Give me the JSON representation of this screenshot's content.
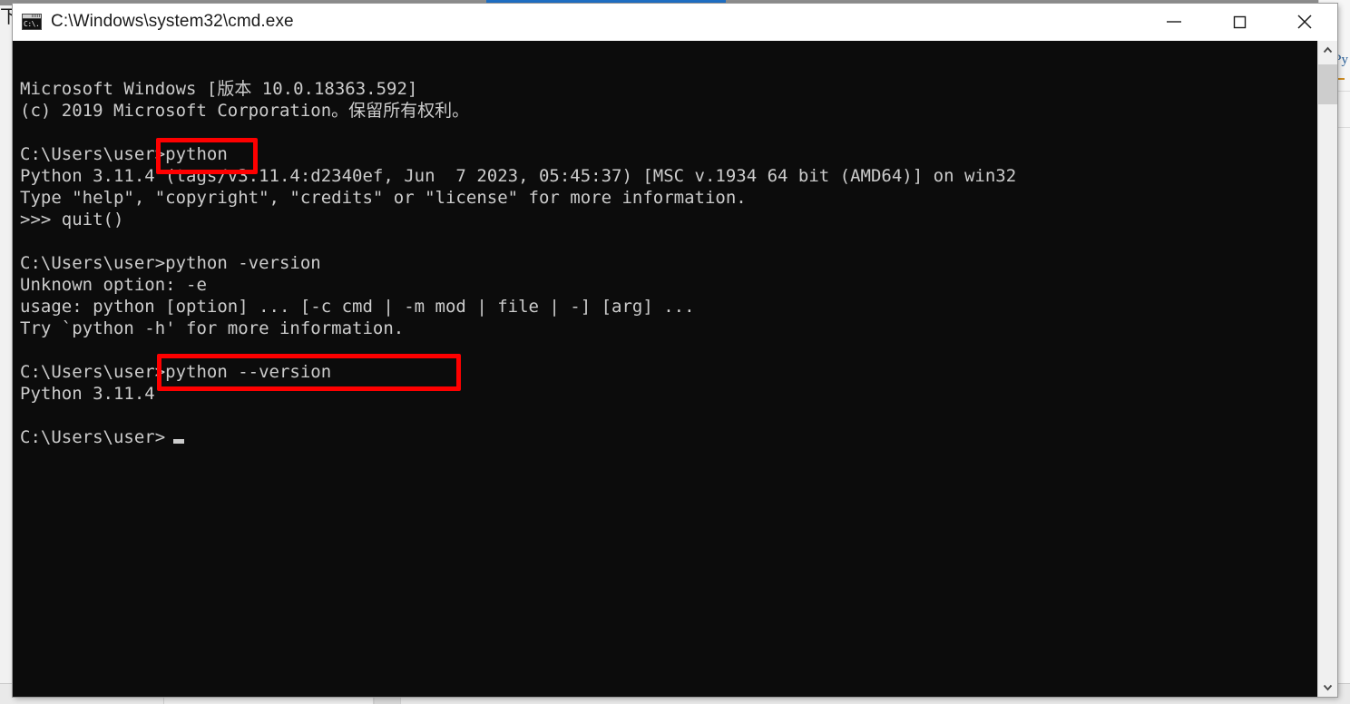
{
  "window": {
    "title": "C:\\Windows\\system32\\cmd.exe",
    "icon": "cmd-icon",
    "icon_glyph": "C:\\.",
    "controls": {
      "minimize_label": "Minimize",
      "maximize_label": "Maximize",
      "close_label": "Close"
    },
    "colors": {
      "titlebar_bg": "#ffffff",
      "titlebar_fg": "#1b1b1b",
      "console_bg": "#0c0c0c",
      "console_fg": "#cccccc",
      "highlight": "#fe0000",
      "scrollbar_track": "#f0f0f0",
      "scrollbar_thumb": "#cdcdcd"
    }
  },
  "console": {
    "lines": [
      "Microsoft Windows [版本 10.0.18363.592]",
      "(c) 2019 Microsoft Corporation。保留所有权利。",
      "",
      "C:\\Users\\user>python",
      "Python 3.11.4 (tags/v3.11.4:d2340ef, Jun  7 2023, 05:45:37) [MSC v.1934 64 bit (AMD64)] on win32",
      "Type \"help\", \"copyright\", \"credits\" or \"license\" for more information.",
      ">>> quit()",
      "",
      "C:\\Users\\user>python -version",
      "Unknown option: -e",
      "usage: python [option] ... [-c cmd | -m mod | file | -] [arg] ...",
      "Try `python -h' for more information.",
      "",
      "C:\\Users\\user>python --version",
      "Python 3.11.4",
      "",
      "C:\\Users\\user>"
    ],
    "text": "Microsoft Windows [版本 10.0.18363.592]\n(c) 2019 Microsoft Corporation。保留所有权利。\n\nC:\\Users\\user>python\nPython 3.11.4 (tags/v3.11.4:d2340ef, Jun  7 2023, 05:45:37) [MSC v.1934 64 bit (AMD64)] on win32\nType \"help\", \"copyright\", \"credits\" or \"license\" for more information.\n>>> quit()\n\nC:\\Users\\user>python -version\nUnknown option: -e\nusage: python [option] ... [-c cmd | -m mod | file | -] [arg] ...\nTry `python -h' for more information.\n\nC:\\Users\\user>python --version\nPython 3.11.4\n\nC:\\Users\\user>",
    "prompt": "C:\\Users\\user>",
    "cursor": "block-cursor"
  },
  "annotations": [
    {
      "name": "highlight-python-command",
      "text": "python"
    },
    {
      "name": "highlight-python-version-command",
      "text": "python --version"
    }
  ],
  "scrollbar": {
    "up_arrow": "chevron-up-icon",
    "down_arrow": "chevron-down-icon",
    "thumb": "scrollbar-thumb"
  },
  "background": {
    "glyph": "下",
    "right_label": "Py"
  }
}
